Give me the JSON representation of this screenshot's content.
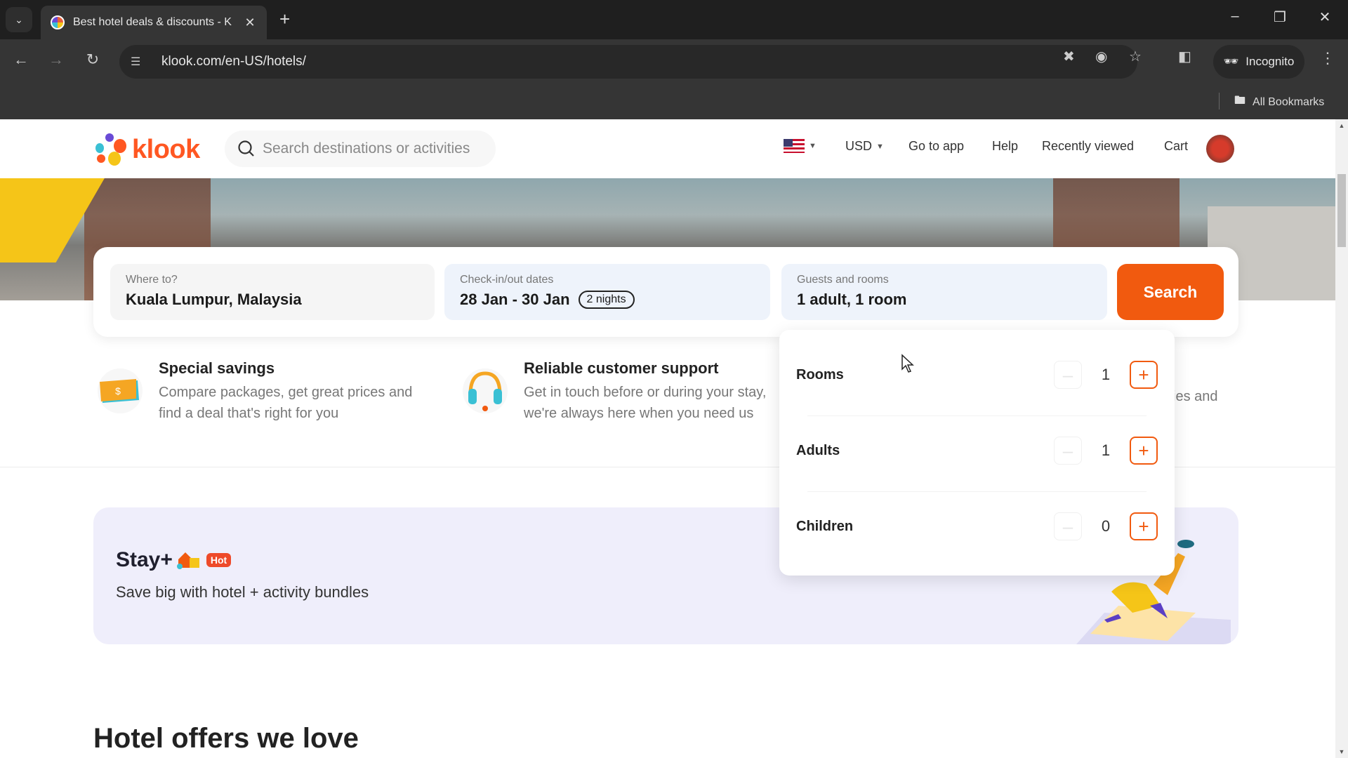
{
  "browser": {
    "tab_title": "Best hotel deals & discounts - K",
    "url": "klook.com/en-US/hotels/",
    "incognito_label": "Incognito",
    "bookmarks_label": "All Bookmarks"
  },
  "header": {
    "logo_text": "klook",
    "search_placeholder": "Search destinations or activities",
    "currency": "USD",
    "nav": [
      "Go to app",
      "Help",
      "Recently viewed",
      "Cart"
    ]
  },
  "search_form": {
    "destination_label": "Where to?",
    "destination_value": "Kuala Lumpur, Malaysia",
    "dates_label": "Check-in/out dates",
    "dates_value": "28 Jan - 30 Jan",
    "nights_badge": "2 nights",
    "guests_label": "Guests and rooms",
    "guests_value": "1 adult, 1 room",
    "search_button": "Search"
  },
  "guests_panel": {
    "rows": [
      {
        "label": "Rooms",
        "value": "1"
      },
      {
        "label": "Adults",
        "value": "1"
      },
      {
        "label": "Children",
        "value": "0"
      }
    ]
  },
  "features": [
    {
      "title": "Special savings",
      "desc": "Compare packages, get great prices and find a deal that's right for you"
    },
    {
      "title": "Reliable customer support",
      "desc": "Get in touch before or during your stay, we're always here when you need us"
    },
    {
      "title": "",
      "desc": "cies and"
    }
  ],
  "stay_banner": {
    "title": "Stay+",
    "badge": "Hot",
    "subtitle": "Save big with hotel + activity bundles"
  },
  "offers_heading": "Hotel offers we love",
  "colors": {
    "brand": "#ff5722",
    "search_button": "#f15a0f",
    "hot_badge": "#ee4a2a"
  }
}
